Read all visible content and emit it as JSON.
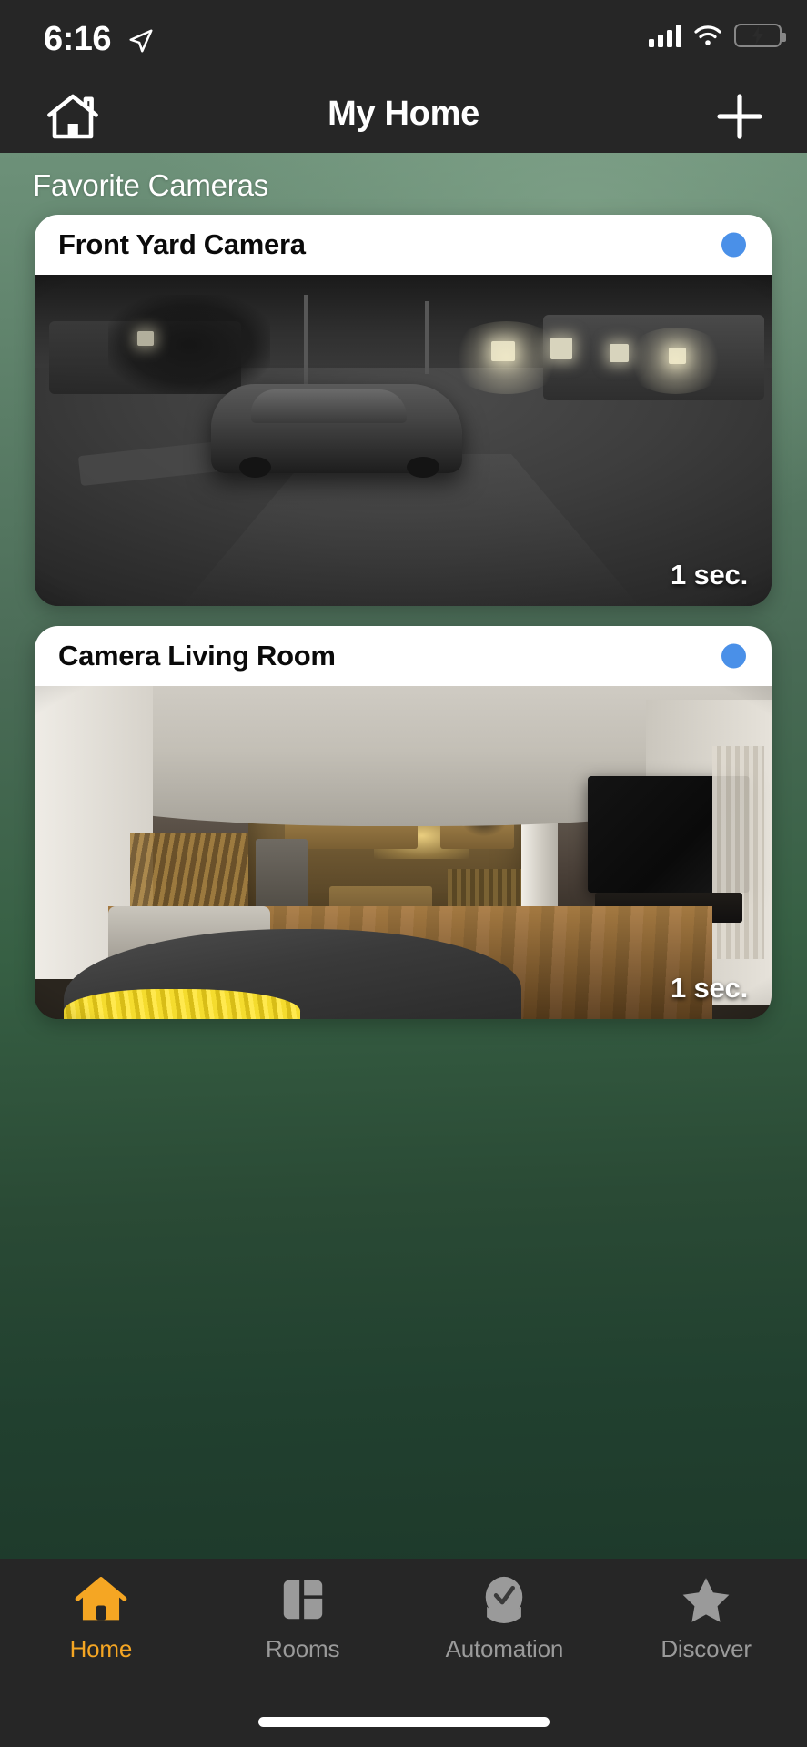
{
  "status_bar": {
    "time": "6:16",
    "location_icon": "location-arrow-icon",
    "signal_icon": "cellular-signal-icon",
    "wifi_icon": "wifi-icon",
    "battery_icon": "battery-charging-icon",
    "battery_color": "#4CD964"
  },
  "nav_bar": {
    "home_icon": "house-outline-icon",
    "title": "My Home",
    "add_icon": "plus-icon"
  },
  "main": {
    "section_title": "Favorite Cameras",
    "background_gradient_top": "#6d9179",
    "background_gradient_bottom": "#1e3a2b",
    "cameras": [
      {
        "name": "Front Yard Camera",
        "status_dot_color": "#4a90e8",
        "timestamp": "1 sec.",
        "scene": "night-driveway-with-car"
      },
      {
        "name": "Camera Living Room",
        "status_dot_color": "#4a90e8",
        "timestamp": "1 sec.",
        "scene": "living-room-interior"
      }
    ]
  },
  "tab_bar": {
    "active_color": "#f5a623",
    "inactive_color": "#9a9a9a",
    "items": [
      {
        "label": "Home",
        "icon": "house-filled-icon",
        "active": true
      },
      {
        "label": "Rooms",
        "icon": "rooms-grid-icon",
        "active": false
      },
      {
        "label": "Automation",
        "icon": "clock-check-icon",
        "active": false
      },
      {
        "label": "Discover",
        "icon": "star-icon",
        "active": false
      }
    ]
  }
}
